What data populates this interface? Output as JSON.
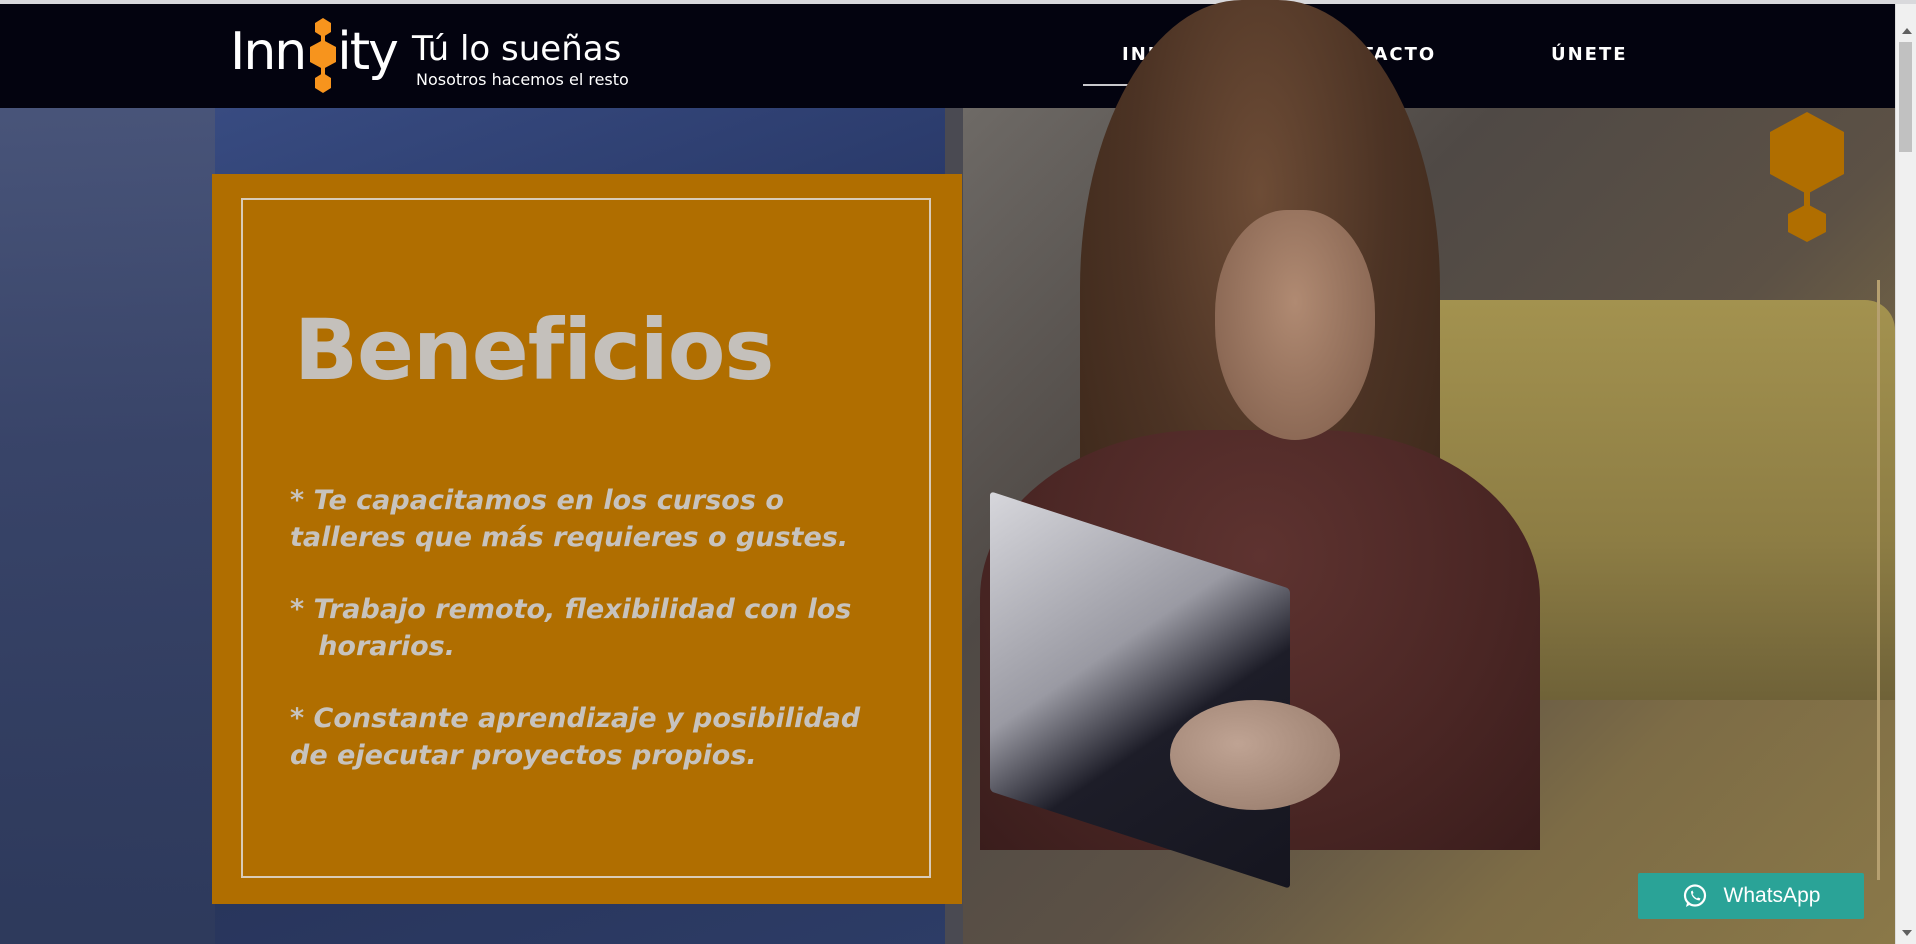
{
  "header": {
    "logo_text": "Innoity",
    "tagline": "Tú lo sueñas",
    "tagline_sub": "Nosotros hacemos el resto",
    "nav": [
      {
        "label": "INICIO",
        "active": true
      },
      {
        "label": "CONTACTO",
        "active": false
      },
      {
        "label": "ÚNETE",
        "active": false
      }
    ]
  },
  "hero": {
    "title": "Beneficios",
    "benefits": [
      {
        "line1": "* Te capacitamos en los cursos o",
        "line2": "talleres  que más requieres o gustes."
      },
      {
        "line1": "* Trabajo remoto, flexibilidad con los",
        "line2": "   horarios."
      },
      {
        "line1": "* Constante aprendizaje y posibilidad",
        "line2": "de ejecutar proyectos propios."
      }
    ]
  },
  "whatsapp": {
    "label": "WhatsApp"
  },
  "colors": {
    "header_bg": "#03030f",
    "card_orange": "#b06e00",
    "logo_orange": "#f7941d",
    "whatsapp_green": "#2aa397"
  },
  "icons": {
    "logo_mark": "hexagon-chain-icon",
    "whatsapp": "whatsapp-icon"
  }
}
